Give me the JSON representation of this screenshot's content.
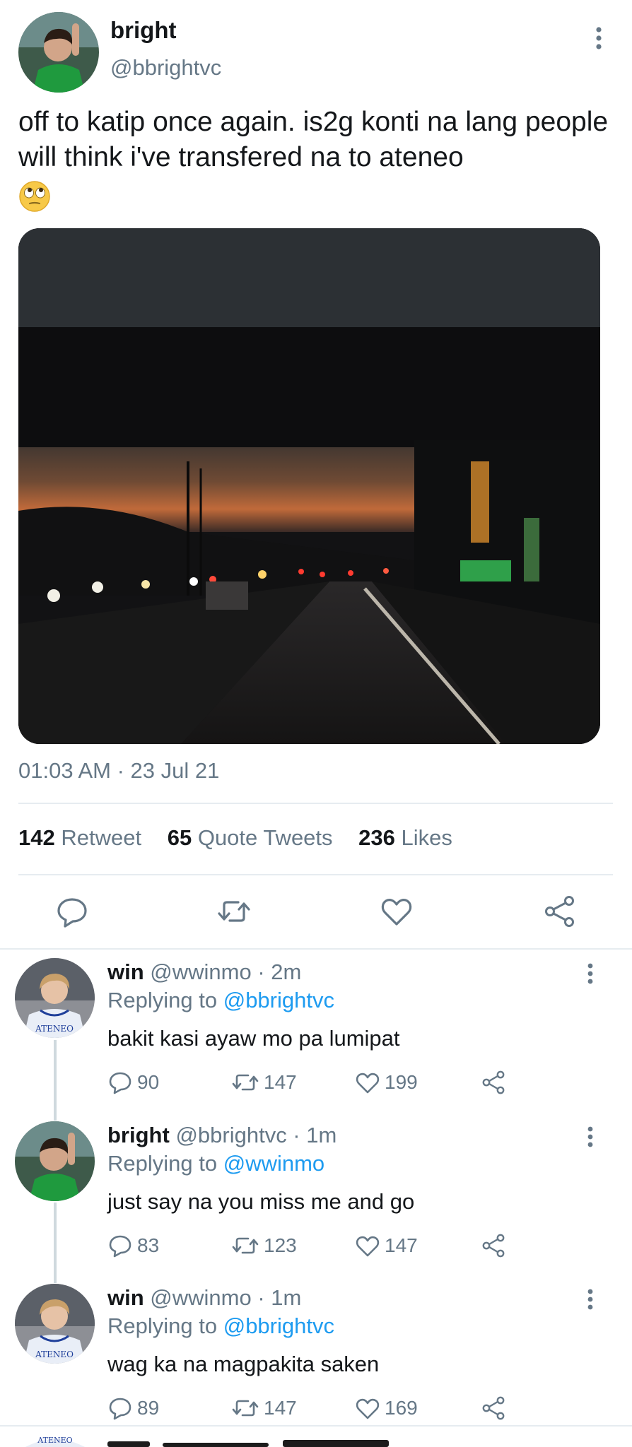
{
  "main_tweet": {
    "author_name": "bright",
    "author_handle": "@bbrightvc",
    "text": "off to katip once again. is2g konti na lang people will think i've transfered na to ateneo",
    "emoji_icon": "face-with-rolling-eyes-icon",
    "timestamp": "01:03 AM · 23 Jul 21",
    "stats": {
      "retweets_count": "142",
      "retweets_label": "Retweet",
      "quotes_count": "65",
      "quotes_label": "Quote Tweets",
      "likes_count": "236",
      "likes_label": "Likes"
    },
    "action_icons": [
      "reply-icon",
      "retweet-icon",
      "like-icon",
      "share-icon"
    ]
  },
  "replies": [
    {
      "name": "win",
      "handle_time": "@wwinmo · 2m",
      "replying_prefix": "Replying to",
      "replying_to": "@bbrightvc",
      "text": "bakit kasi ayaw mo pa lumipat",
      "reply_count": "90",
      "retweet_count": "147",
      "like_count": "199",
      "avatar_badge": "ATENEO"
    },
    {
      "name": "bright",
      "handle_time": "@bbrightvc · 1m",
      "replying_prefix": "Replying to",
      "replying_to": "@wwinmo",
      "text": "just say na you miss me and go",
      "reply_count": "83",
      "retweet_count": "123",
      "like_count": "147"
    },
    {
      "name": "win",
      "handle_time": "@wwinmo · 1m",
      "replying_prefix": "Replying to",
      "replying_to": "@bbrightvc",
      "text": "wag ka na magpakita saken",
      "reply_count": "89",
      "retweet_count": "147",
      "like_count": "169",
      "avatar_badge": "ATENEO"
    }
  ],
  "peek_avatar_badge": "ATENEO",
  "colors": {
    "text_primary": "#14171a",
    "text_secondary": "#657786",
    "link": "#1d9bf0",
    "divider": "#e6ecf0",
    "thread_line": "#cfd9de"
  }
}
